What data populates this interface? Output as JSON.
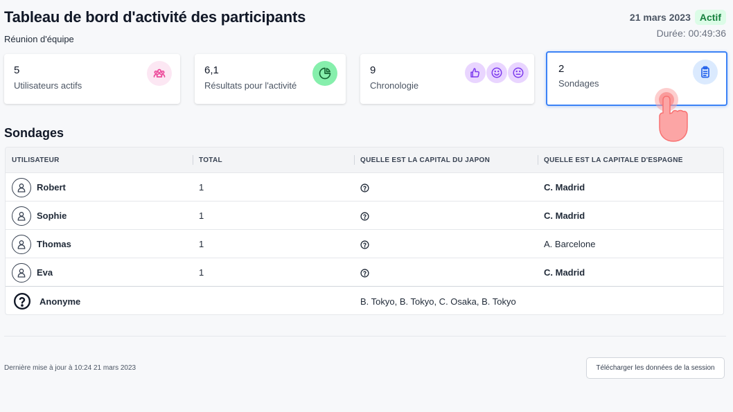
{
  "header": {
    "title": "Tableau de bord d'activité des participants",
    "subtitle": "Réunion d'équipe",
    "date": "21 mars 2023",
    "status": "Actif",
    "duration": "Durée: 00:49:36"
  },
  "cards": [
    {
      "value": "5",
      "label": "Utilisateurs actifs",
      "icon": "users-icon",
      "color": "#ec4899",
      "bg": "#fce7f3"
    },
    {
      "value": "6,1",
      "label": "Résultats pour l'activité",
      "icon": "pie-chart-icon",
      "color": "#15803d",
      "bg": "#86efac"
    },
    {
      "value": "9",
      "label": "Chronologie",
      "icons": [
        "thumbs-up-icon",
        "smile-icon",
        "neutral-face-icon"
      ],
      "color": "#7c3aed",
      "bg": "#e9d5ff"
    },
    {
      "value": "2",
      "label": "Sondages",
      "icon": "clipboard-icon",
      "color": "#2563eb",
      "bg": "#dbeafe",
      "selected": true
    }
  ],
  "section_title": "Sondages",
  "table": {
    "columns": [
      "UTILISATEUR",
      "TOTAL",
      "QUELLE EST LA CAPITAL DU JAPON",
      "QUELLE EST LA CAPITALE D'ESPAGNE"
    ],
    "rows": [
      {
        "user": "Robert",
        "total": "1",
        "q1": "question-icon",
        "q2": "C. Madrid",
        "q2_bold": true
      },
      {
        "user": "Sophie",
        "total": "1",
        "q1": "question-icon",
        "q2": "C. Madrid",
        "q2_bold": true
      },
      {
        "user": "Thomas",
        "total": "1",
        "q1": "question-icon",
        "q2": "A. Barcelone",
        "q2_bold": false
      },
      {
        "user": "Eva",
        "total": "1",
        "q1": "question-icon",
        "q2": "C. Madrid",
        "q2_bold": true
      }
    ],
    "anonymous": {
      "label": "Anonyme",
      "answers": "B. Tokyo, B. Tokyo, C. Osaka, B. Tokyo"
    }
  },
  "footer": {
    "updated": "Dernière mise à jour à 10:24 21 mars 2023",
    "download_label": "Télécharger les données de la session"
  },
  "colors": {
    "accent": "#3b82f6",
    "status_bg": "#dcfce7",
    "status_text": "#15803d",
    "pointer": "#f87171"
  }
}
